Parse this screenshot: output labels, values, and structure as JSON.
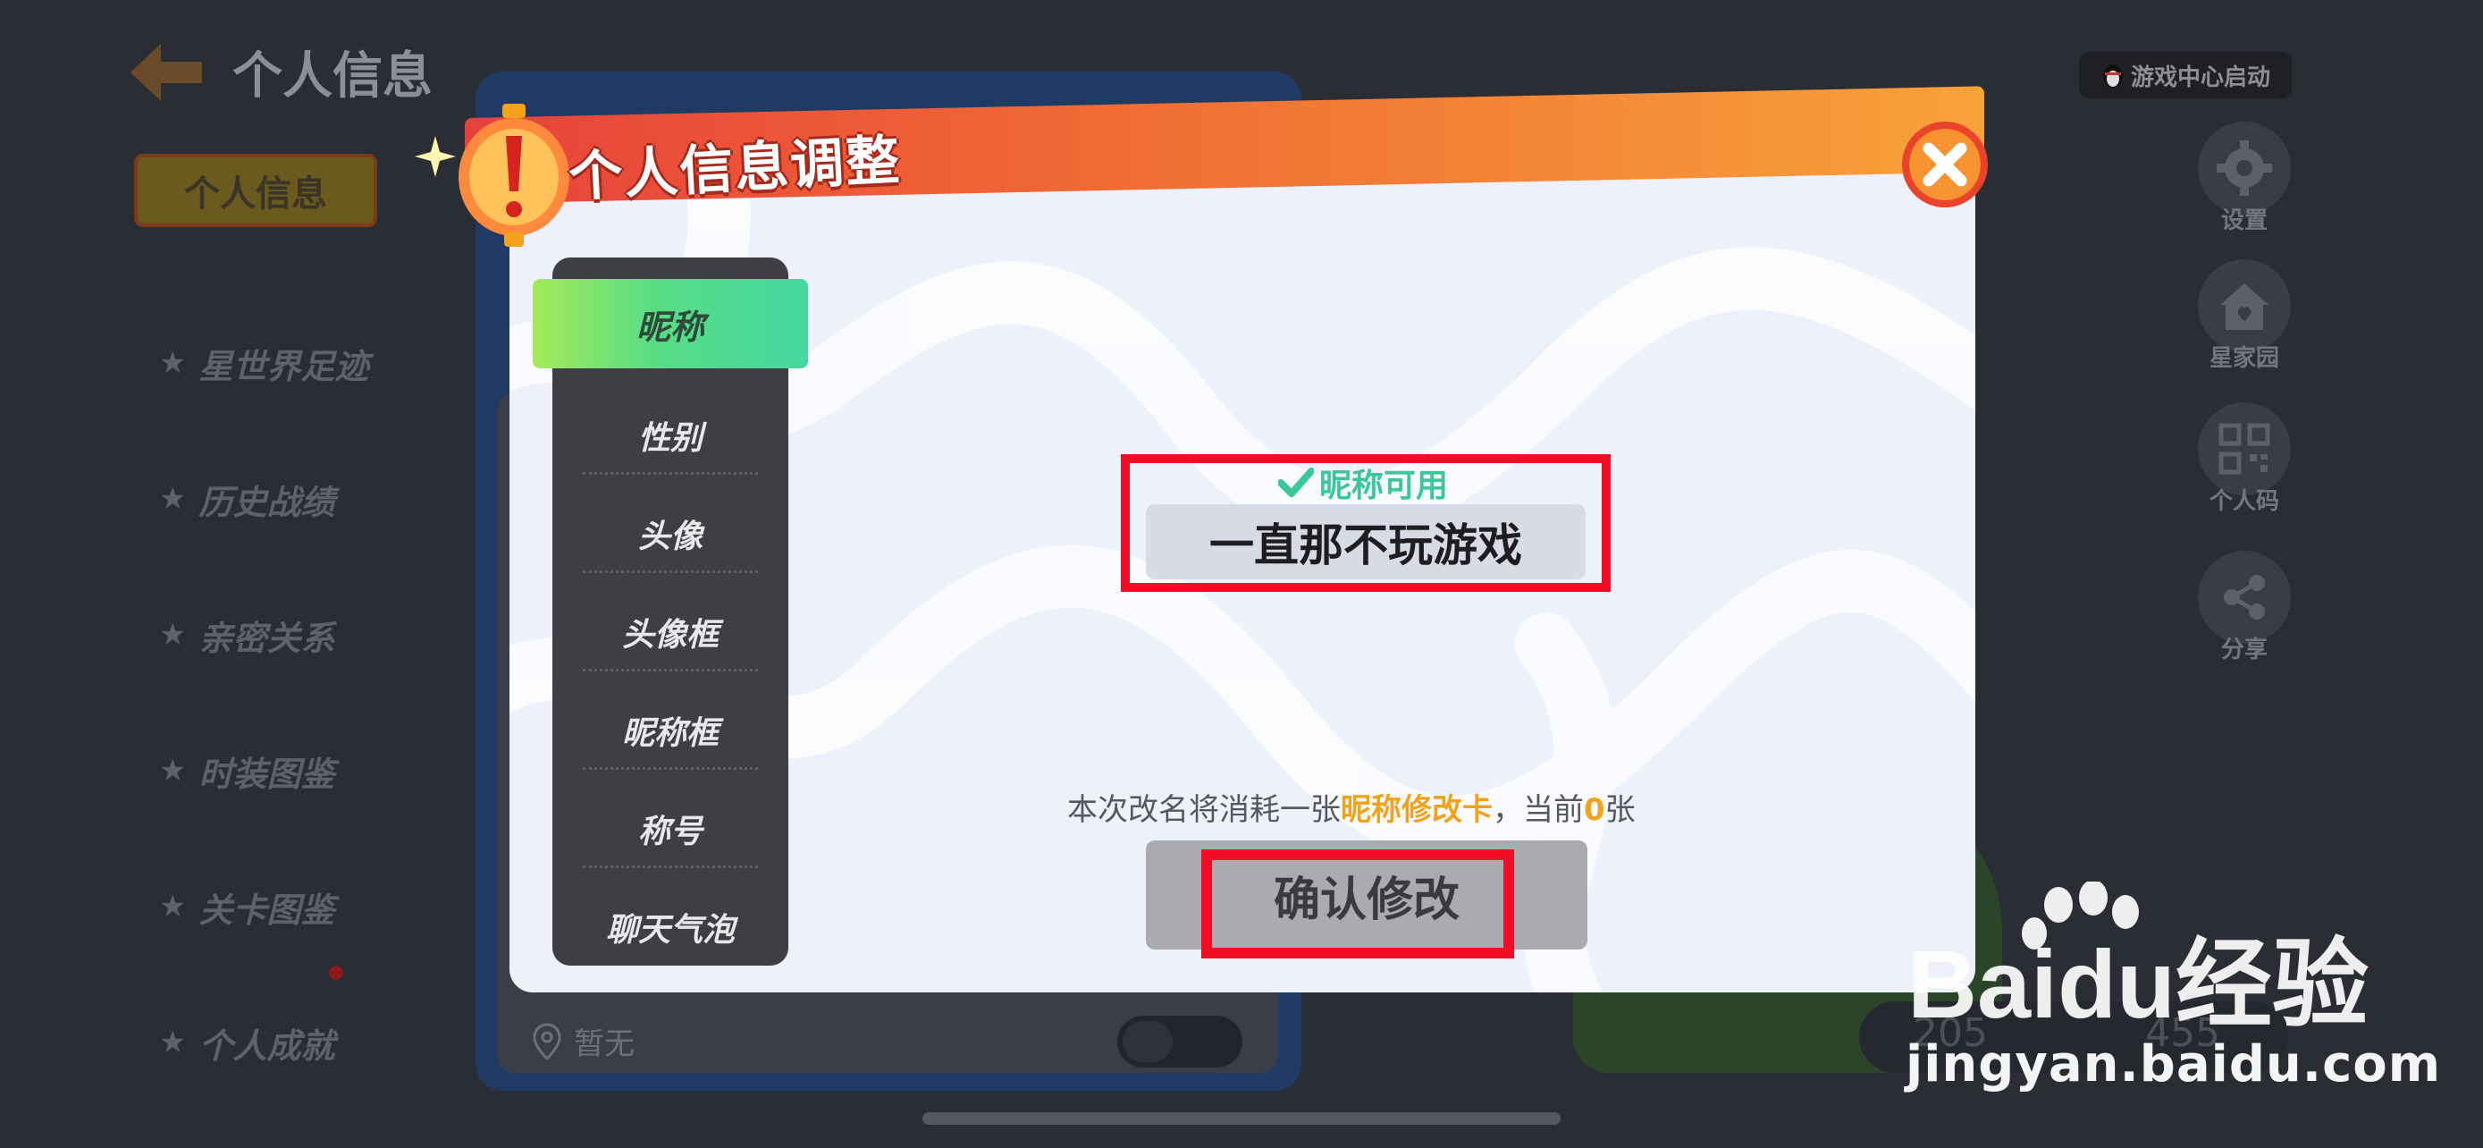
{
  "background": {
    "title": "个人信息",
    "active_tab": "个人信息",
    "menu": [
      "星世界足迹",
      "历史战绩",
      "亲密关系",
      "时装图鉴",
      "关卡图鉴",
      "个人成就"
    ],
    "location_text": "暂无",
    "launch_button": "游戏中心启动",
    "side_buttons": [
      {
        "label": "设置",
        "icon": "gear-icon"
      },
      {
        "label": "星家园",
        "icon": "home-icon"
      },
      {
        "label": "个人码",
        "icon": "qr-code-icon"
      },
      {
        "label": "分享",
        "icon": "share-icon"
      }
    ],
    "stat_left": "205",
    "stat_right": "455"
  },
  "dialog": {
    "title": "个人信息调整",
    "tabs": [
      "昵称",
      "性别",
      "头像",
      "头像框",
      "昵称框",
      "称号",
      "聊天气泡"
    ],
    "active_tab_index": 0,
    "status_text": "昵称可用",
    "status_color": "#3cc79a",
    "nickname_value": "一直那不玩游戏",
    "notice_prefix": "本次改名将消耗一张",
    "notice_highlight": "昵称修改卡",
    "notice_middle": "，当前",
    "notice_count": "0",
    "notice_suffix": "张",
    "confirm_label": "确认修改"
  },
  "watermark": {
    "brand": "Baidu经验",
    "url": "jingyan.baidu.com"
  },
  "colors": {
    "header_start": "#e8413c",
    "header_end": "#f8a23a",
    "active_tab_green": "#57dd86",
    "highlight_orange": "#f4a21c",
    "annotation_red": "#f10d26"
  }
}
